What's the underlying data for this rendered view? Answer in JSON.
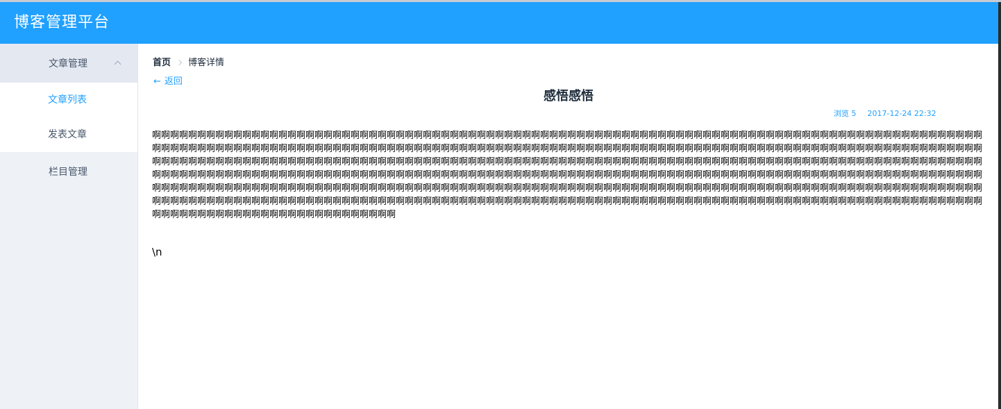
{
  "header": {
    "title": "博客管理平台"
  },
  "sidebar": {
    "group": {
      "label": "文章管理",
      "expanded": true,
      "items": [
        {
          "label": "文章列表",
          "active": true
        },
        {
          "label": "发表文章",
          "active": false
        }
      ]
    },
    "top_items": [
      {
        "label": "栏目管理"
      }
    ]
  },
  "breadcrumb": {
    "home": "首页",
    "current": "博客详情"
  },
  "back": {
    "arrow": "←",
    "label": "返回"
  },
  "article": {
    "title": "感悟感悟",
    "views_label": "浏览 5",
    "date": "2017-12-24 22:32",
    "body": "啊啊啊啊啊啊啊啊啊啊啊啊啊啊啊啊啊啊啊啊啊啊啊啊啊啊啊啊啊啊啊啊啊啊啊啊啊啊啊啊啊啊啊啊啊啊啊啊啊啊啊啊啊啊啊啊啊啊啊啊啊啊啊啊啊啊啊啊啊啊啊啊啊啊啊啊啊啊啊啊啊啊啊啊啊啊啊啊啊啊啊啊啊啊啊啊啊啊啊啊啊啊啊啊啊啊啊啊啊啊啊啊啊啊啊啊啊啊啊啊啊啊啊啊啊啊啊啊啊啊啊啊啊啊啊啊啊啊啊啊啊啊啊啊啊啊啊啊啊啊啊啊啊啊啊啊啊啊啊啊啊啊啊啊啊啊啊啊啊啊啊啊啊啊啊啊啊啊啊啊啊啊啊啊啊啊啊啊啊啊啊啊啊啊啊啊啊啊啊啊啊啊啊啊啊啊啊啊啊啊啊啊啊啊啊啊啊啊啊啊啊啊啊啊啊啊啊啊啊啊啊啊啊啊啊啊啊啊啊啊啊啊啊啊啊啊啊啊啊啊啊啊啊啊啊啊啊啊啊啊啊啊啊啊啊啊啊啊啊啊啊啊啊啊啊啊啊啊啊啊啊啊啊啊啊啊啊啊啊啊啊啊啊啊啊啊啊啊啊啊啊啊啊啊啊啊啊啊啊啊啊啊啊啊啊啊啊啊啊啊啊啊啊啊啊啊啊啊啊啊啊啊啊啊啊啊啊啊啊啊啊啊啊啊啊啊啊啊啊啊啊啊啊啊啊啊啊啊啊啊啊啊啊啊啊啊啊啊啊啊啊啊啊啊啊啊啊啊啊啊啊啊啊啊啊啊啊啊啊啊啊啊啊啊啊啊啊啊啊啊啊啊啊啊啊啊啊啊啊啊啊啊啊啊啊啊啊啊啊啊啊啊啊啊啊啊啊啊啊啊啊啊啊啊啊啊啊啊啊啊啊啊啊啊啊啊啊啊啊啊啊啊啊啊啊啊啊啊啊啊啊啊啊啊啊啊啊啊啊啊啊啊啊啊啊啊啊啊啊啊啊啊啊啊啊啊啊啊啊啊啊啊啊啊啊啊啊啊啊啊啊啊啊啊啊啊啊啊啊啊啊啊啊啊啊啊啊啊啊啊啊啊啊啊啊啊啊啊啊啊啊啊啊啊啊啊啊啊啊啊啊啊啊啊啊啊啊啊啊啊啊啊啊啊啊啊啊啊啊啊啊啊啊啊啊啊啊啊啊啊啊啊啊啊啊啊啊啊啊",
    "extra": "\\n"
  },
  "colors": {
    "header_bg": "#20a0ff",
    "accent": "#20a0ff",
    "sidebar_bg": "#eef1f6",
    "text": "#1f2d3d"
  }
}
